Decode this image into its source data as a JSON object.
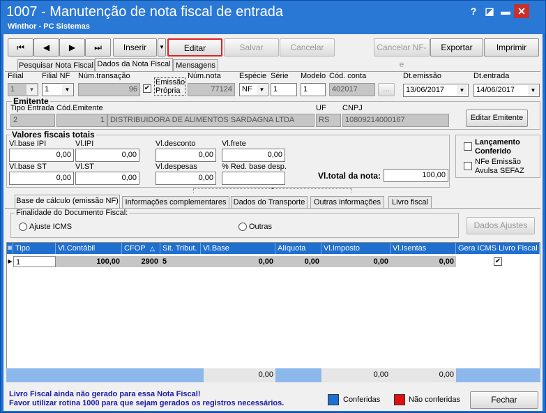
{
  "window": {
    "title": "1007 - Manutenção de nota fiscal de entrada",
    "subtitle": "Winthor - PC Sistemas",
    "help": "?",
    "restore": "◪",
    "minimize": "▬",
    "close": "✕"
  },
  "toolbar": {
    "first": "⏮",
    "prev": "◀",
    "next": "▶",
    "last": "⏭",
    "insert": "Inserir",
    "edit": "Editar",
    "save": "Salvar",
    "cancel": "Cancelar",
    "cancel_nfe": "Cancelar NF-e",
    "export": "Exportar",
    "print": "Imprimir"
  },
  "tabs": [
    "Pesquisar Nota Fiscal",
    "Dados da Nota Fiscal",
    "Mensagens"
  ],
  "fields": {
    "filial_label": "Filial",
    "filial": "1",
    "filial_nf_label": "Filial NF",
    "filial_nf": "1",
    "num_transacao_label": "Núm.transação",
    "num_transacao": "96",
    "emissao_propria": "Emissão Própria",
    "num_nota_label": "Núm.nota",
    "num_nota": "77124",
    "especie_label": "Espécie",
    "especie": "NF",
    "serie_label": "Série",
    "serie": "1",
    "modelo_label": "Modelo",
    "modelo": "1",
    "cod_conta_label": "Cód. conta",
    "cod_conta": "402017",
    "dt_emissao_label": "Dt.emissão",
    "dt_emissao": "13/06/2017",
    "dt_entrada_label": "Dt.entrada",
    "dt_entrada": "14/06/2017",
    "ellipsis": "..."
  },
  "emitente": {
    "title": "Emitente",
    "tipo_label": "Tipo Entrada",
    "tipo": "2",
    "cod_label": "Cód.Emitente",
    "cod": "1",
    "nome": "DISTRIBUIDORA DE ALIMENTOS SARDAGNA LTDA",
    "uf_label": "UF",
    "uf": "RS",
    "cnpj_label": "CNPJ",
    "cnpj": "10809214000167",
    "edit_btn": "Editar Emitente"
  },
  "valores": {
    "title": "Valores fiscais totais",
    "base_ipi_label": "Vl.base IPI",
    "base_ipi": "0,00",
    "ipi_label": "Vl.IPI",
    "ipi": "0,00",
    "desconto_label": "Vl.desconto",
    "desconto": "0,00",
    "frete_label": "Vl.frete",
    "frete": "0,00",
    "base_st_label": "Vl.base ST",
    "base_st": "0,00",
    "st_label": "Vl.ST",
    "st": "0,00",
    "despesas_label": "Vl.despesas",
    "despesas": "0,00",
    "red_base_label": "% Red. base desp.",
    "red_base": "",
    "total_label": "Vl.total da nota:",
    "total": "100,00"
  },
  "side": {
    "lanc_conferido": "Lançamento Conferido",
    "nfe_avulsa": "NFe Emissão Avulsa SEFAZ"
  },
  "subtabs": [
    "Base de cálculo (emissão NF)",
    "Informações complementares",
    "Dados do Transporte",
    "Outras informações",
    "Livro fiscal"
  ],
  "finalidade": {
    "title": "Finalidade do Documento Fiscal:",
    "ajuste": "Ajuste ICMS",
    "outras": "Outras",
    "dados_ajustes": "Dados Ajustes"
  },
  "grid": {
    "headers": [
      "Tipo",
      "Vl.Contábil",
      "CFOP",
      "Sit. Tribut.",
      "Vl.Base",
      "Alíquota",
      "Vl.Imposto",
      "Vl.Isentas",
      "Gera ICMS Livro Fiscal"
    ],
    "row": [
      "1",
      "100,00",
      "2900",
      "5",
      "0,00",
      "0,00",
      "0,00",
      "0,00"
    ],
    "footer": [
      "0,00",
      "0,00",
      "0,00"
    ]
  },
  "status": {
    "line1": "Livro Fiscal ainda não gerado para essa Nota Fiscal!",
    "line2": "Favor utilizar rotina 1000 para que sejam gerados os registros necessários.",
    "conferidas": "Conferidas",
    "nao_conferidas": "Não conferidas",
    "close": "Fechar"
  },
  "colors": {
    "conferidas": "#1e6fd4",
    "nao_conferidas": "#e01010"
  }
}
